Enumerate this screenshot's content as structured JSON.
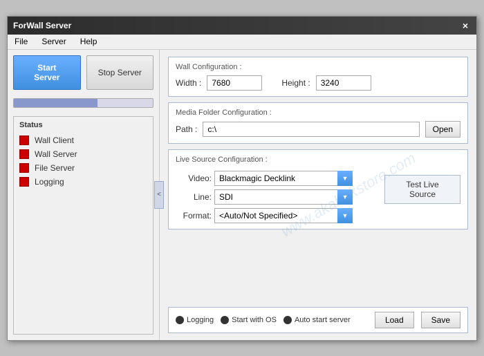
{
  "window": {
    "title": "ForWall Server",
    "close_label": "×"
  },
  "menu": {
    "items": [
      {
        "label": "File"
      },
      {
        "label": "Server"
      },
      {
        "label": "Help"
      }
    ]
  },
  "left_panel": {
    "start_button": "Start Server",
    "stop_button": "Stop Server",
    "status_title": "Status",
    "status_items": [
      {
        "label": "Wall Client"
      },
      {
        "label": "Wall Server"
      },
      {
        "label": "File Server"
      },
      {
        "label": "Logging"
      }
    ]
  },
  "right_panel": {
    "wall_config": {
      "title": "Wall Configuration :",
      "width_label": "Width :",
      "width_value": "7680",
      "height_label": "Height :",
      "height_value": "3240"
    },
    "media_folder": {
      "title": "Media Folder Configuration :",
      "path_label": "Path :",
      "path_value": "c:\\",
      "open_label": "Open"
    },
    "live_source": {
      "title": "Live Source Configuration :",
      "video_label": "Video:",
      "video_value": "Blackmagic Decklink",
      "video_options": [
        "Blackmagic Decklink"
      ],
      "line_label": "Line:",
      "line_value": "SDI",
      "line_options": [
        "SDI"
      ],
      "format_label": "Format:",
      "format_value": "<Auto/Not Specified>",
      "format_options": [
        "<Auto/Not Specified>"
      ],
      "test_button": "Test Live Source"
    },
    "bottom": {
      "logging_label": "Logging",
      "start_os_label": "Start with OS",
      "auto_start_label": "Auto start server",
      "load_label": "Load",
      "save_label": "Save"
    }
  },
  "collapse_icon": "<",
  "watermark": "www.akabekstore.com"
}
